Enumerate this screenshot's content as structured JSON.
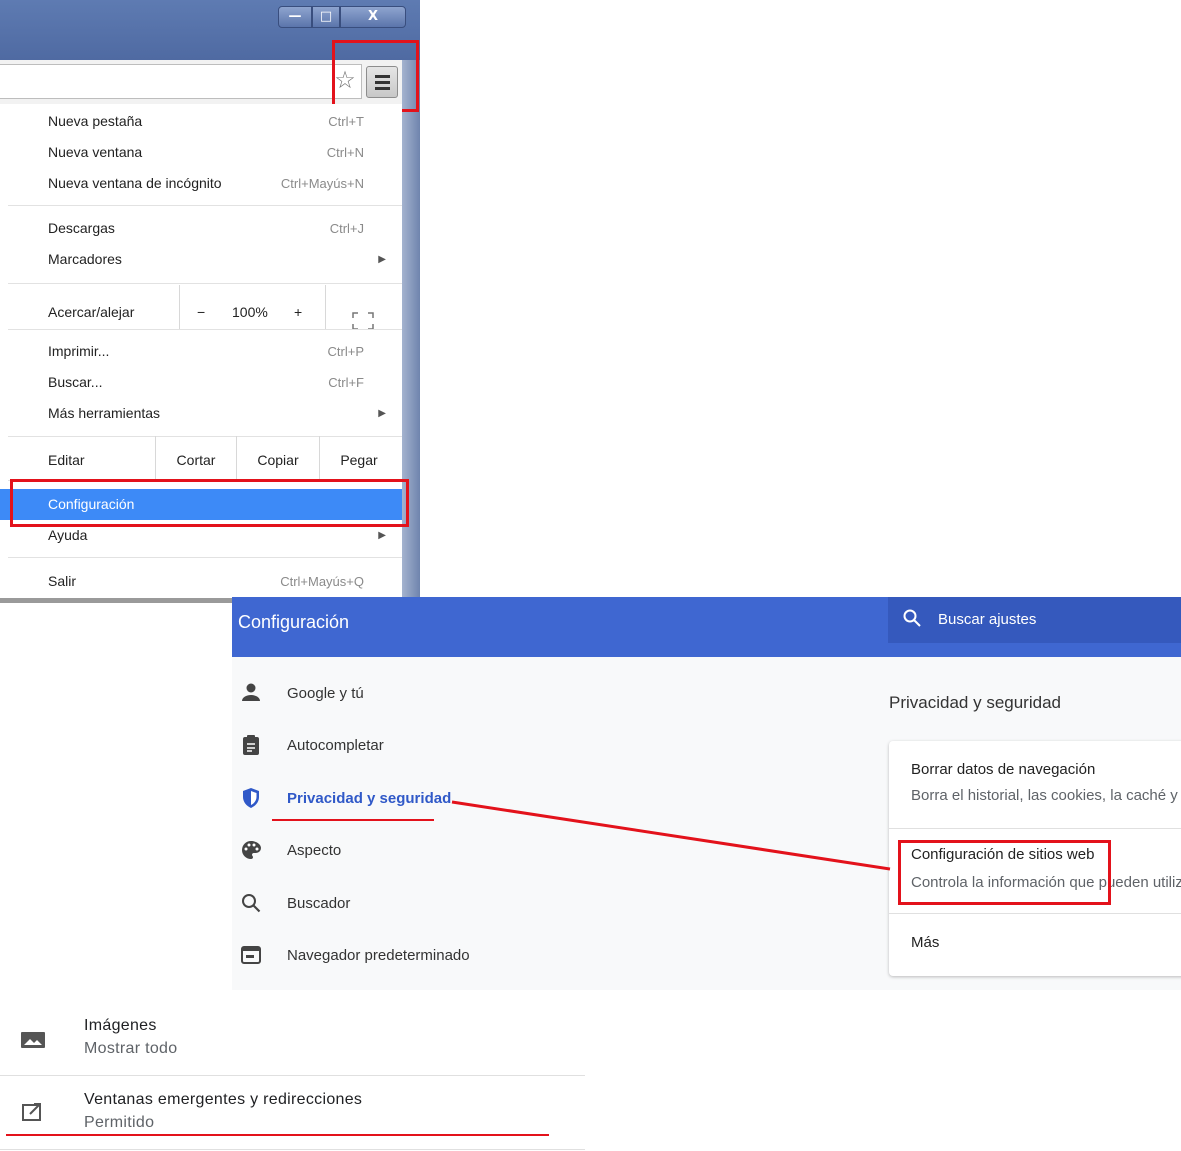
{
  "window": {
    "controls": {
      "minimize": "—",
      "maximize": "□",
      "close": "X"
    }
  },
  "menu": {
    "items": [
      {
        "label": "Nueva pestaña",
        "shortcut": "Ctrl+T"
      },
      {
        "label": "Nueva ventana",
        "shortcut": "Ctrl+N"
      },
      {
        "label": "Nueva ventana de incógnito",
        "shortcut": "Ctrl+Mayús+N"
      },
      {
        "label": "Descargas",
        "shortcut": "Ctrl+J"
      },
      {
        "label": "Marcadores",
        "shortcut": ""
      },
      {
        "label": "Imprimir...",
        "shortcut": "Ctrl+P"
      },
      {
        "label": "Buscar...",
        "shortcut": "Ctrl+F"
      },
      {
        "label": "Más herramientas",
        "shortcut": ""
      },
      {
        "label": "Configuración",
        "shortcut": ""
      },
      {
        "label": "Ayuda",
        "shortcut": ""
      },
      {
        "label": "Salir",
        "shortcut": "Ctrl+Mayús+Q"
      }
    ],
    "zoom": {
      "label": "Acercar/alejar",
      "minus": "−",
      "value": "100%",
      "plus": "+"
    },
    "edit": {
      "label": "Editar",
      "cut": "Cortar",
      "copy": "Copiar",
      "paste": "Pegar"
    }
  },
  "settings": {
    "title": "Configuración",
    "search_placeholder": "Buscar ajustes",
    "nav": [
      {
        "label": "Google y tú",
        "icon": "person-icon"
      },
      {
        "label": "Autocompletar",
        "icon": "clipboard-icon"
      },
      {
        "label": "Privacidad y seguridad",
        "icon": "shield-icon"
      },
      {
        "label": "Aspecto",
        "icon": "palette-icon"
      },
      {
        "label": "Buscador",
        "icon": "search-icon"
      },
      {
        "label": "Navegador predeterminado",
        "icon": "browser-icon"
      }
    ],
    "section_title": "Privacidad y seguridad",
    "card": [
      {
        "title": "Borrar datos de navegación",
        "subtitle": "Borra el historial, las cookies, la caché y mu"
      },
      {
        "title": "Configuración de sitios web",
        "subtitle": "Controla la información que pueden utilizar"
      },
      {
        "title": "Más",
        "subtitle": ""
      }
    ],
    "accent_color": "#3f67d1"
  },
  "site_settings": [
    {
      "title": "Imágenes",
      "subtitle": "Mostrar todo",
      "icon": "image-icon"
    },
    {
      "title": "Ventanas emergentes y redirecciones",
      "subtitle": "Permitido",
      "icon": "popup-icon"
    }
  ],
  "annotation_color": "#e3121b"
}
